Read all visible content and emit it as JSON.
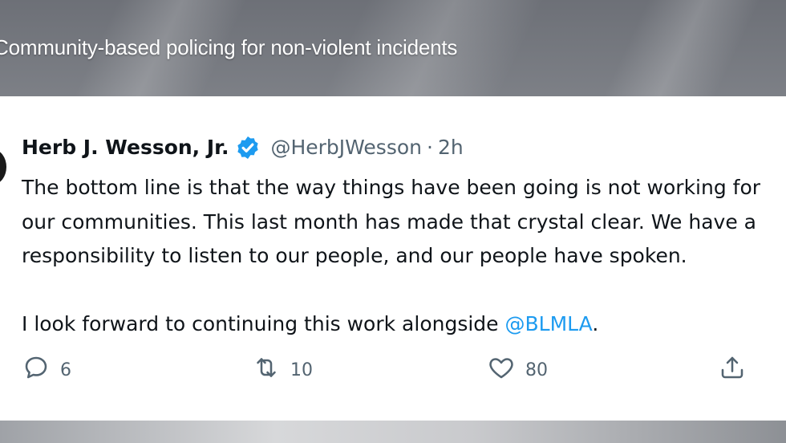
{
  "headline": "Community-based policing for non-violent incidents",
  "tweet": {
    "display_name": "Herb J. Wesson, Jr.",
    "handle": "@HerbJWesson",
    "separator": "·",
    "timestamp": "2h",
    "body_lines": [
      "The bottom line is that the way things have been going is not working for",
      "our communities. This last month has made that crystal clear. We have a",
      "responsibility to listen to our people, and our people have spoken."
    ],
    "closing_prefix": "I look forward to continuing this work alongside ",
    "mention": "@BLMLA",
    "closing_suffix": "."
  },
  "actions": {
    "reply": {
      "icon": "reply-icon",
      "count": "6"
    },
    "retweet": {
      "icon": "retweet-icon",
      "count": "10"
    },
    "like": {
      "icon": "heart-icon",
      "count": "80"
    },
    "share": {
      "icon": "share-icon"
    }
  },
  "colors": {
    "verified_blue": "#1d9bf0",
    "mention_blue": "#1d9bf0",
    "secondary_text": "#536471",
    "primary_text": "#0f1419"
  }
}
